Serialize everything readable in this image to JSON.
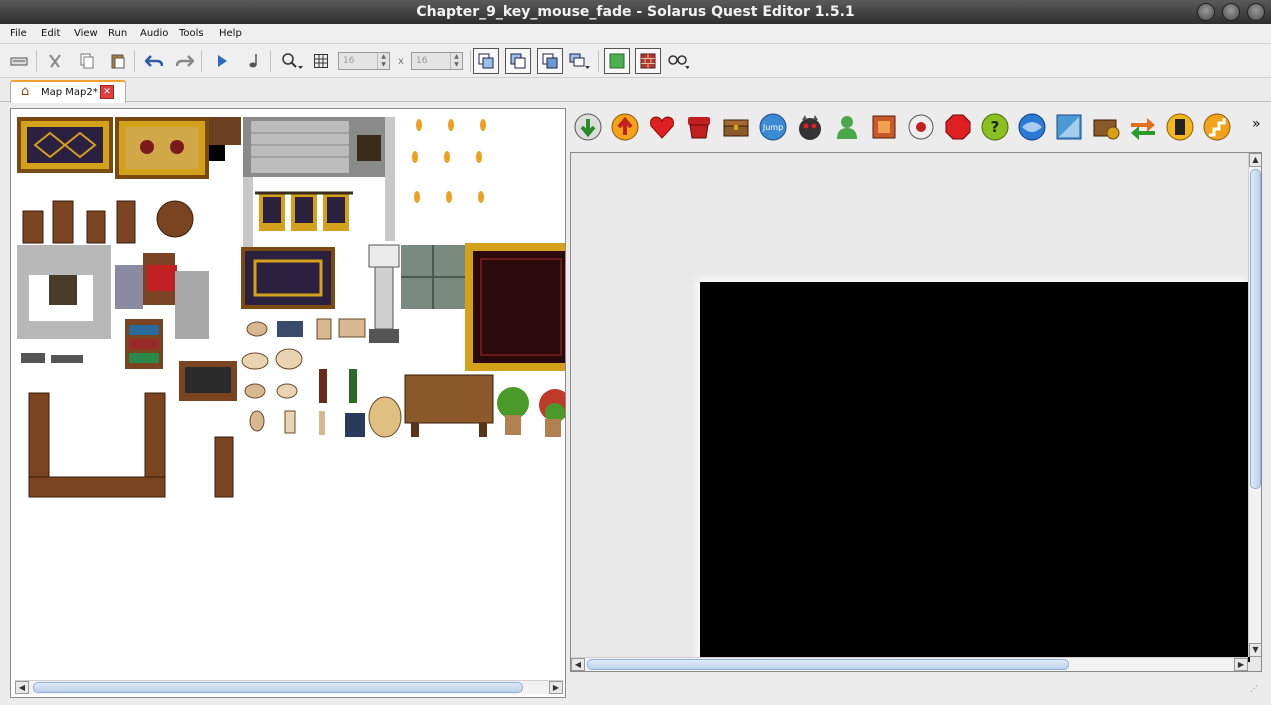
{
  "window": {
    "title": "Chapter_9_key_mouse_fade - Solarus Quest Editor 1.5.1"
  },
  "menu": [
    "File",
    "Edit",
    "View",
    "Run",
    "Audio",
    "Tools",
    "Help"
  ],
  "toolbar": {
    "grid_width": "16",
    "grid_height": "16",
    "times": "x",
    "icons": [
      "close-project-icon",
      "cut-icon",
      "copy-icon",
      "paste-icon",
      "undo-icon",
      "redo-icon",
      "run-icon",
      "music-icon",
      "zoom-icon",
      "grid-icon",
      "layer-low-icon",
      "layer-intermediate-icon",
      "layer-high-icon",
      "layers-menu-icon",
      "show-tiles-icon",
      "show-walls-icon",
      "show-entities-icon"
    ]
  },
  "tab": {
    "label": "Map Map2*"
  },
  "entitybar": {
    "jump_label": "Jump",
    "more": "»",
    "icons": [
      "destination-icon",
      "teletransporter-icon",
      "pickable-icon",
      "destructible-icon",
      "chest-icon",
      "jumper-icon",
      "enemy-icon",
      "npc-icon",
      "block-icon",
      "switch-icon",
      "wall-icon",
      "sensor-icon",
      "crystal-icon",
      "crystal-block-icon",
      "shop-treasure-icon",
      "stream-icon",
      "door-icon",
      "stairs-icon"
    ]
  },
  "colors": {
    "title_bar": "#3a3a3a",
    "tab_accent": "#f0a030",
    "map_background": "#000000",
    "map_canvas": "#e8e8e8"
  }
}
